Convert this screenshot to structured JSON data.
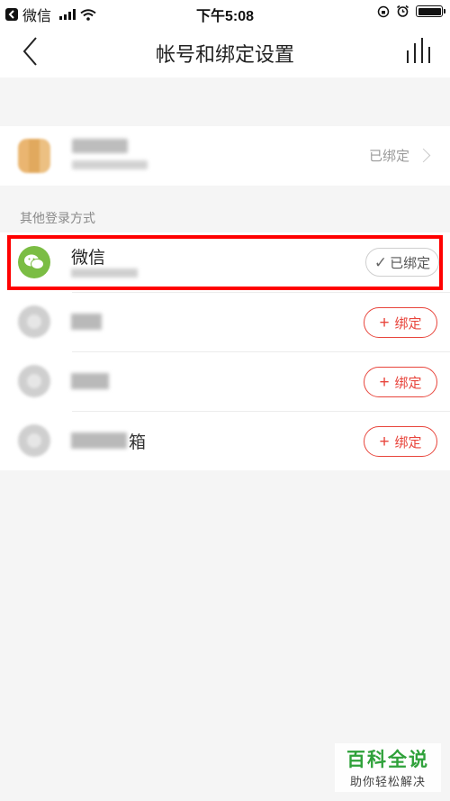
{
  "status_bar": {
    "carrier": "微信",
    "time": "下午5:08"
  },
  "nav": {
    "title": "帐号和绑定设置",
    "back_icon": "chevron-left-icon",
    "stats_icon": "bar-stats-icon"
  },
  "account": {
    "bound_label": "已绑定"
  },
  "section": {
    "label": "其他登录方式"
  },
  "login_methods": [
    {
      "name": "微信",
      "status": "已绑定",
      "icon": "wechat-icon",
      "bound": true
    },
    {
      "name": "",
      "action": "绑定",
      "icon": "blurred-icon",
      "bound": false
    },
    {
      "name": "",
      "action": "绑定",
      "icon": "blurred-icon",
      "bound": false
    },
    {
      "name_suffix": "箱",
      "action": "绑定",
      "icon": "blurred-icon",
      "bound": false
    }
  ],
  "colors": {
    "accent_red": "#e8453c",
    "wechat_green": "#7bbd44",
    "highlight_red": "#ff0000",
    "watermark_green": "#2fa13a"
  },
  "watermark": {
    "title": "百科全说",
    "subtitle": "助你轻松解决"
  }
}
